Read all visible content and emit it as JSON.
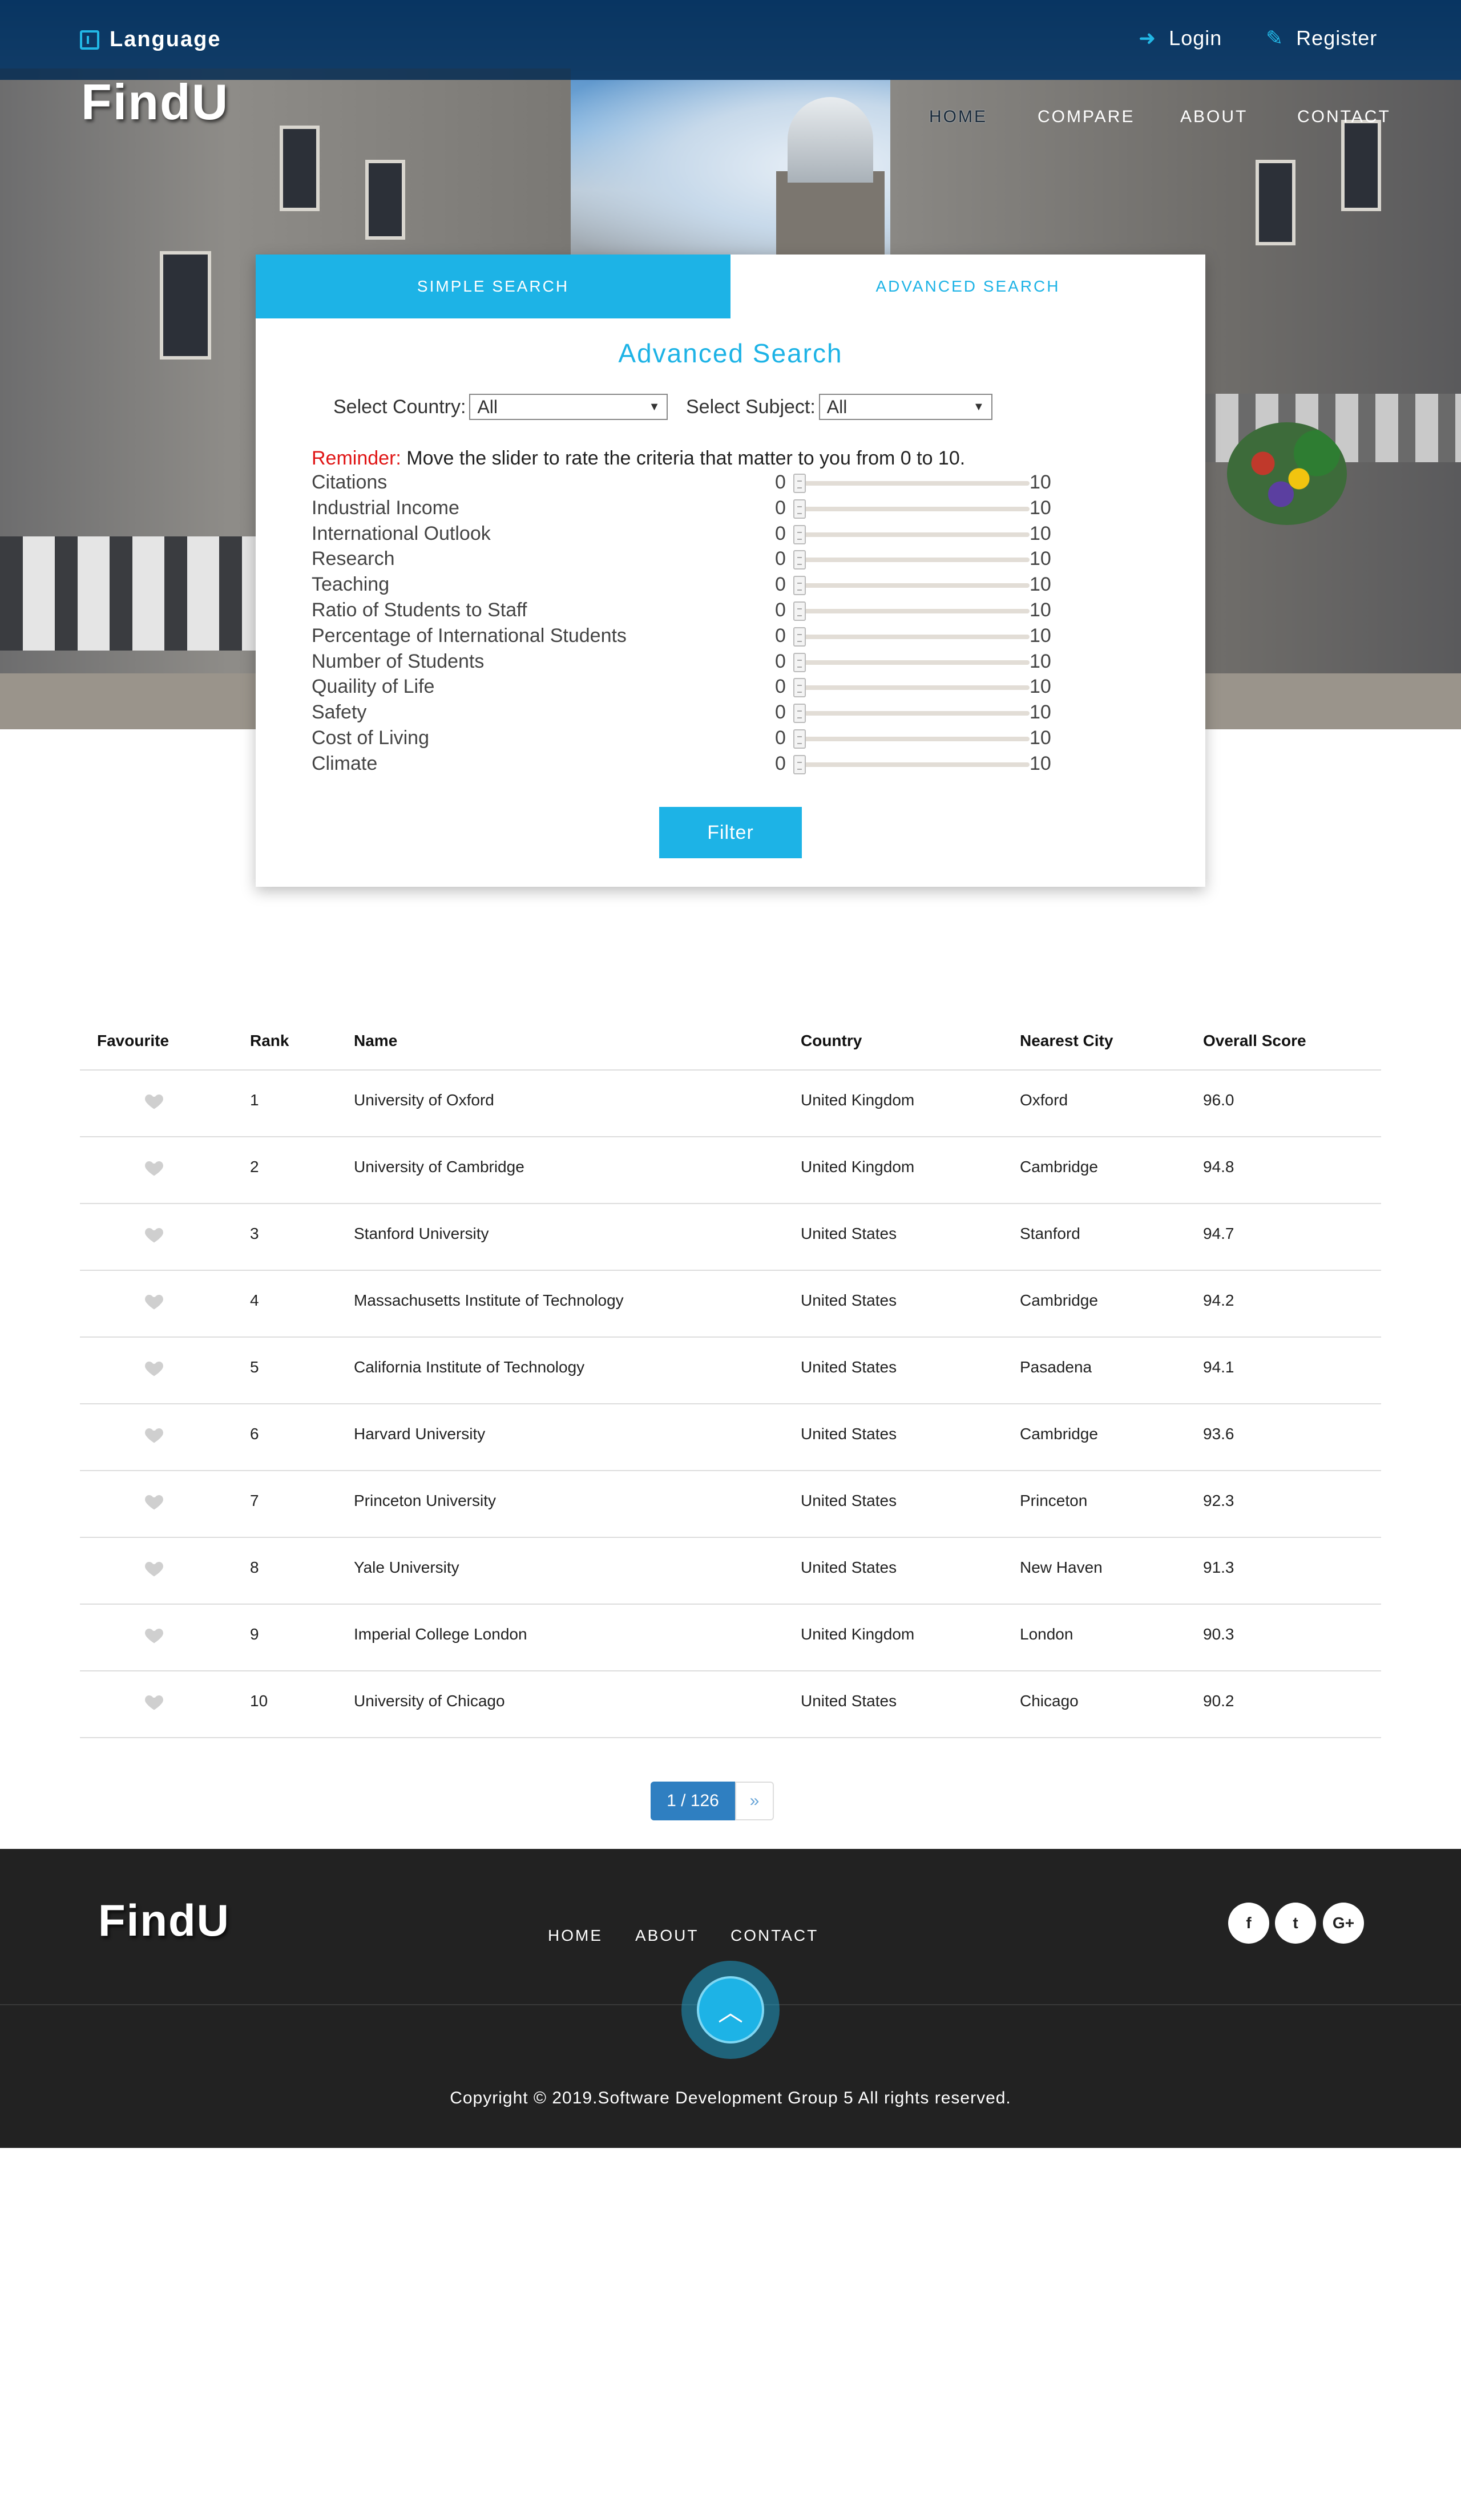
{
  "header": {
    "language_label": "Language",
    "login_label": "Login",
    "register_label": "Register",
    "brand": "FindU",
    "nav": [
      {
        "label": "HOME",
        "active": true
      },
      {
        "label": "COMPARE",
        "active": false
      },
      {
        "label": "ABOUT",
        "active": false
      },
      {
        "label": "CONTACT",
        "active": false
      }
    ]
  },
  "search": {
    "tabs": {
      "simple": "SIMPLE SEARCH",
      "advanced": "ADVANCED SEARCH"
    },
    "title": "Advanced Search",
    "country_label": "Select Country:",
    "country_value": "All",
    "subject_label": "Select Subject:",
    "subject_value": "All",
    "reminder_label": "Reminder:",
    "reminder_text": " Move the slider to rate the criteria that matter to you from 0 to 10.",
    "criteria": [
      {
        "name": "Citations",
        "min": "0",
        "max": "10",
        "value": 0
      },
      {
        "name": "Industrial Income",
        "min": "0",
        "max": "10",
        "value": 0
      },
      {
        "name": "International Outlook",
        "min": "0",
        "max": "10",
        "value": 0
      },
      {
        "name": "Research",
        "min": "0",
        "max": "10",
        "value": 0
      },
      {
        "name": "Teaching",
        "min": "0",
        "max": "10",
        "value": 0
      },
      {
        "name": "Ratio of Students to Staff",
        "min": "0",
        "max": "10",
        "value": 0
      },
      {
        "name": "Percentage of International Students",
        "min": "0",
        "max": "10",
        "value": 0
      },
      {
        "name": "Number of Students",
        "min": "0",
        "max": "10",
        "value": 0
      },
      {
        "name": "Quaility of Life",
        "min": "0",
        "max": "10",
        "value": 0
      },
      {
        "name": "Safety",
        "min": "0",
        "max": "10",
        "value": 0
      },
      {
        "name": "Cost of Living",
        "min": "0",
        "max": "10",
        "value": 0
      },
      {
        "name": "Climate",
        "min": "0",
        "max": "10",
        "value": 0
      }
    ],
    "filter_label": "Filter"
  },
  "table": {
    "headers": {
      "fav": "Favourite",
      "rank": "Rank",
      "name": "Name",
      "country": "Country",
      "city": "Nearest City",
      "score": "Overall Score"
    },
    "rows": [
      {
        "rank": "1",
        "name": "University of Oxford",
        "country": "United Kingdom",
        "city": "Oxford",
        "score": "96.0"
      },
      {
        "rank": "2",
        "name": "University of Cambridge",
        "country": "United Kingdom",
        "city": "Cambridge",
        "score": "94.8"
      },
      {
        "rank": "3",
        "name": "Stanford University",
        "country": "United States",
        "city": "Stanford",
        "score": "94.7"
      },
      {
        "rank": "4",
        "name": "Massachusetts Institute of Technology",
        "country": "United States",
        "city": "Cambridge",
        "score": "94.2"
      },
      {
        "rank": "5",
        "name": "California Institute of Technology",
        "country": "United States",
        "city": "Pasadena",
        "score": "94.1"
      },
      {
        "rank": "6",
        "name": "Harvard University",
        "country": "United States",
        "city": "Cambridge",
        "score": "93.6"
      },
      {
        "rank": "7",
        "name": "Princeton University",
        "country": "United States",
        "city": "Princeton",
        "score": "92.3"
      },
      {
        "rank": "8",
        "name": "Yale University",
        "country": "United States",
        "city": "New Haven",
        "score": "91.3"
      },
      {
        "rank": "9",
        "name": "Imperial College London",
        "country": "United Kingdom",
        "city": "London",
        "score": "90.3"
      },
      {
        "rank": "10",
        "name": "University of Chicago",
        "country": "United States",
        "city": "Chicago",
        "score": "90.2"
      }
    ]
  },
  "pagination": {
    "current": "1 / 126",
    "next": "»"
  },
  "footer": {
    "brand": "FindU",
    "nav": [
      "HOME",
      "ABOUT",
      "CONTACT"
    ],
    "social": [
      {
        "icon": "facebook-icon",
        "glyph": "f"
      },
      {
        "icon": "twitter-icon",
        "glyph": "t"
      },
      {
        "icon": "google-plus-icon",
        "glyph": "G+"
      }
    ],
    "copyright": "Copyright © 2019.Software Development Group 5 All rights reserved."
  },
  "colors": {
    "accent": "#1db3e6",
    "pager": "#2f7fc1",
    "reminder": "#e01515",
    "footer_bg": "#222222"
  }
}
